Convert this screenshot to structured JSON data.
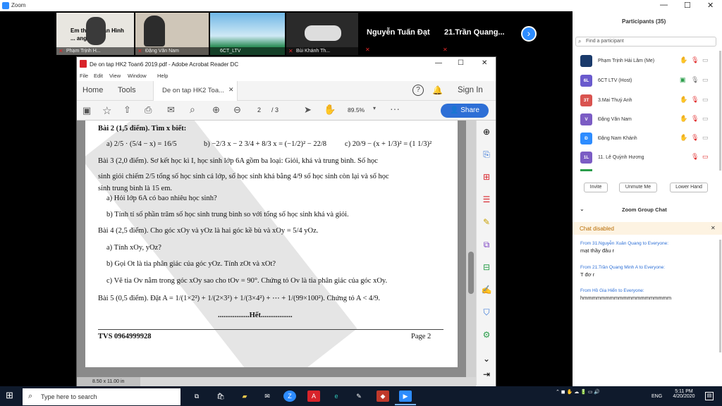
{
  "zoom": {
    "title": "Zoom",
    "win_controls": [
      "—",
      "☐",
      "✕"
    ]
  },
  "videos": [
    {
      "name": "Phạm Trịnh H...",
      "overlay": "Em thấy... màn Hình ... ang ơi"
    },
    {
      "name": "Đặng Văn Nam"
    },
    {
      "name": "6CT_LTV"
    },
    {
      "name": "Bùi Khánh Th..."
    }
  ],
  "strip_names": {
    "n1": "Nguyễn Tuấn Đạt",
    "n2": "21.Trần Quang..."
  },
  "acrobat": {
    "title": "De on tap HK2 Toan6 2019.pdf - Adobe Acrobat Reader DC",
    "menu": [
      "File",
      "Edit",
      "View",
      "Window",
      "Help"
    ],
    "tabs": {
      "home": "Home",
      "tools": "Tools",
      "doc": "De on tap HK2 Toa...",
      "sign_in": "Sign In"
    },
    "toolbar": {
      "page": "2",
      "of": "/ 3",
      "zoom": "89.5%",
      "share": "Share"
    },
    "status": "8.50 x 11.00 in"
  },
  "doc": {
    "b2": "Bài 2 (1,5 điểm). Tìm x biết:",
    "b2a": "a)  2/5 · (5/4 − x) = 16/5",
    "b2b": "b)  −2/3 x − 2 3/4 + 8/3 x = (−1/2)² − 22/8",
    "b2c": "c)  20/9 − (x + 1/3)² = (1 1/3)²",
    "b3_1": "Bài 3 (2,0 điểm). Sơ kết học kì I, học sinh lớp 6A gồm ba loại: Giỏi, khá và trung bình. Số học",
    "b3_2": "sinh giỏi chiếm 2/5 tổng số học sinh cả lớp, số học sinh khá bằng 4/9 số học sinh còn lại và số học",
    "b3_3": "sinh trung bình là 15 em.",
    "b3a": "a)  Hỏi lớp 6A có bao nhiêu học sinh?",
    "b3b": "b)  Tính tỉ số phần trăm số học sinh trung bình so với tổng số học sinh khá và giỏi.",
    "b4": "Bài 4 (2,5 điểm). Cho góc xOy và yOz là hai góc kề bù và xOy = 5/4 yOz.",
    "b4a": "a)  Tính xOy, yOz?",
    "b4b": "b)  Gọi Ot là tia phân giác của góc yOz. Tính zOt và xOt?",
    "b4c": "c)  Vẽ tia Ov nằm trong góc xOy sao cho tOv = 90°. Chứng tỏ Ov là tia phân giác của góc xOy.",
    "b5": "Bài 5 (0,5 điểm). Đặt A = 1/(1×2²) + 1/(2×3²) + 1/(3×4²) + ⋯ + 1/(99×100²). Chứng tỏ A < 4/9.",
    "end": ".................Hết.................",
    "footer_left": "TVS 0964999928",
    "footer_right": "Page 2"
  },
  "panel": {
    "title": "Participants (35)",
    "search": "Find a participant",
    "participants": [
      {
        "initials": "",
        "name": "Phạm Trịnh Hải Lâm (Me)",
        "color": "#1a3a6b"
      },
      {
        "initials": "6L",
        "name": "6CT LTV (Host)",
        "color": "#6a5acd"
      },
      {
        "initials": "3T",
        "name": "3.Mai Thuý Anh",
        "color": "#d9534f"
      },
      {
        "initials": "V",
        "name": "Đặng Văn Nam",
        "color": "#7b5cc4"
      },
      {
        "initials": "Đ",
        "name": "Đặng Nam Khánh",
        "color": "#2d8cff"
      },
      {
        "initials": "1L",
        "name": "11. Lê Quỳnh Hương",
        "color": "#7b5cc4"
      }
    ],
    "buttons": {
      "invite": "Invite",
      "mute": "Unmute Me",
      "lower": "Lower Hand"
    },
    "chat_title": "Zoom Group Chat",
    "chat_disabled": "Chat disabled",
    "messages": [
      {
        "from": "From 31.Nguyễn Xuân Quang to Everyone:",
        "text": "mạt thầy đâu r"
      },
      {
        "from": "From 21.Trần Quang Minh A to Everyone:",
        "text": "T đơ r"
      },
      {
        "from": "From Hồ Gia Hiển to Everyone:",
        "text": "hmmmmmmmmmmmmmmmmmmmm"
      }
    ]
  },
  "taskbar": {
    "search": "Type here to search",
    "time": "5:11 PM",
    "date": "4/20/2020",
    "lang": "ENG"
  }
}
